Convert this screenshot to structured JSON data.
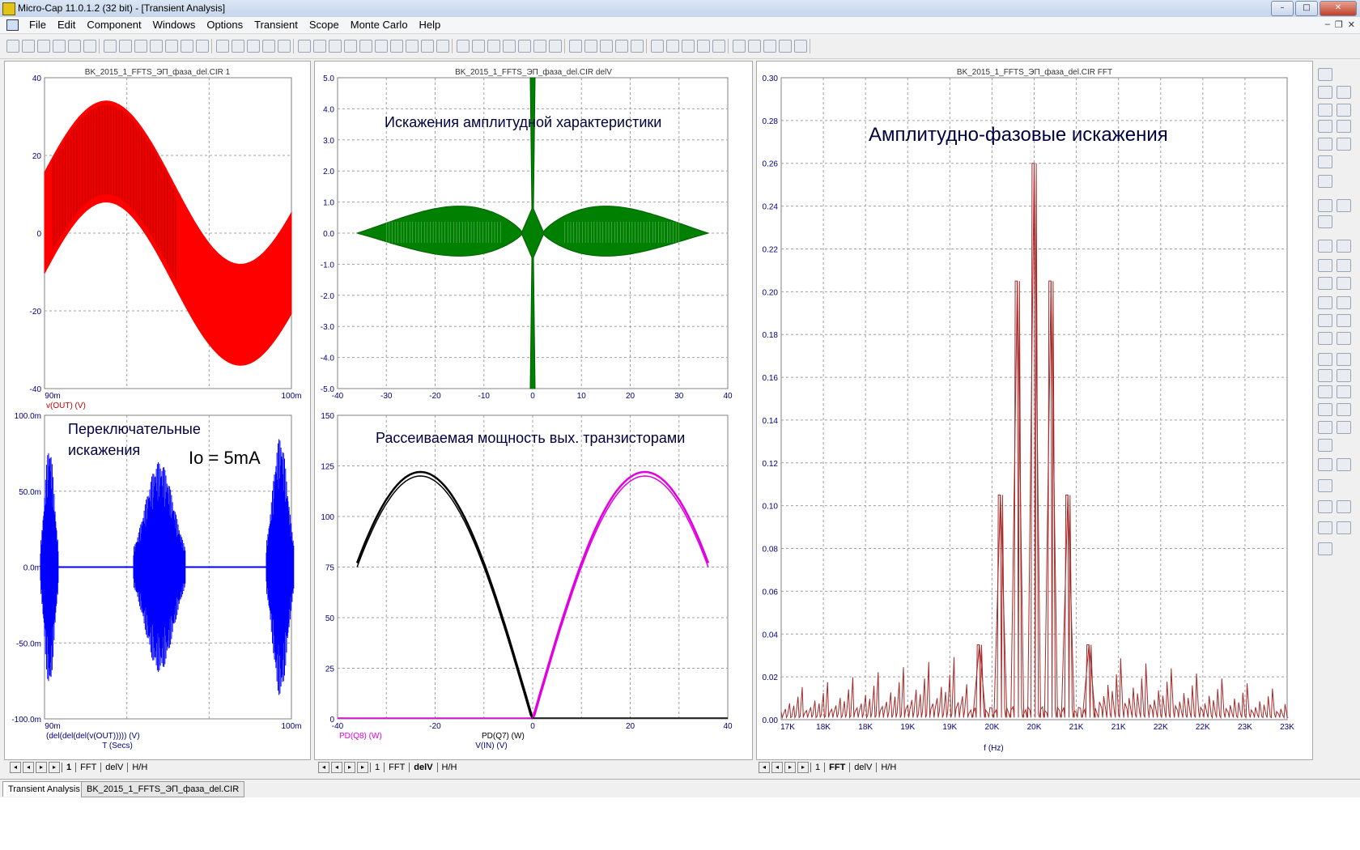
{
  "app": {
    "title": "Micro-Cap 11.0.1.2 (32 bit) - [Transient Analysis]"
  },
  "menu": [
    "File",
    "Edit",
    "Component",
    "Windows",
    "Options",
    "Transient",
    "Scope",
    "Monte Carlo",
    "Help"
  ],
  "panels": {
    "p1": {
      "title": "BK_2015_1_FFTS_ЭП_фаза_del.CIR 1",
      "yticks": [
        "40",
        "20",
        "0",
        "-20",
        "-40"
      ],
      "xticks": [
        "90m",
        "100m"
      ],
      "xlabel": "v(OUT) (V)",
      "color": "#ff0000"
    },
    "p2": {
      "title": "BK_2015_1_FFTS_ЭП_фаза_del.CIR delV",
      "annotation": "Искажения амплитудной характеристики",
      "yticks": [
        "5.0",
        "4.0",
        "3.0",
        "2.0",
        "1.0",
        "0.0",
        "-1.0",
        "-2.0",
        "-3.0",
        "-4.0",
        "-5.0"
      ],
      "xticks": [
        "-40",
        "-30",
        "-20",
        "-10",
        "0",
        "10",
        "20",
        "30",
        "40"
      ],
      "color": "#008000"
    },
    "p3": {
      "title": "BK_2015_1_FFTS_ЭП_фаза_del.CIR FFT",
      "annotation": "Амплитудно-фазовые искажения",
      "yticks": [
        "0.30",
        "0.28",
        "0.26",
        "0.24",
        "0.22",
        "0.20",
        "0.18",
        "0.16",
        "0.14",
        "0.12",
        "0.10",
        "0.08",
        "0.06",
        "0.04",
        "0.02",
        "0.00"
      ],
      "xticks": [
        "17K",
        "18K",
        "18K",
        "19K",
        "19K",
        "20K",
        "20K",
        "21K",
        "21K",
        "22K",
        "22K",
        "23K",
        "23K"
      ],
      "xlabel": "f (Hz)",
      "color": "#a52a2a"
    },
    "p4": {
      "annotation1": "Переключательные",
      "annotation2": "искажения",
      "annotation3": "Io = 5mA",
      "yticks": [
        "100.0m",
        "50.0m",
        "0.0m",
        "-50.0m",
        "-100.0m"
      ],
      "xticks": [
        "90m",
        "100m"
      ],
      "xlabel": "(del(del(del(v(OUT))))) (V)",
      "xlabel2": "T (Secs)",
      "color": "#0000ff"
    },
    "p5": {
      "annotation": "Рассеиваемая мощность вых. транзисторами",
      "yticks": [
        "150",
        "125",
        "100",
        "75",
        "50",
        "25",
        "0"
      ],
      "xticks": [
        "-40",
        "-20",
        "0",
        "20",
        "40"
      ],
      "legend1": "PD(Q8) (W)",
      "legend2": "PD(Q7) (W)",
      "xlabel": "V(IN) (V)",
      "color1": "#000000",
      "color2": "#e000e0"
    }
  },
  "tabs": {
    "left": [
      "1",
      "FFT",
      "delV",
      "H/H"
    ],
    "mid": [
      "1",
      "FFT",
      "delV",
      "H/H"
    ],
    "right": [
      "1",
      "FFT",
      "delV",
      "H/H"
    ]
  },
  "bottom_tabs": [
    "Transient Analysis",
    "BK_2015_1_FFTS_ЭП_фаза_del.CIR"
  ],
  "chart_data": [
    {
      "type": "line",
      "title": "BK_2015_1_FFTS_ЭП_фаза_del.CIR 1",
      "ylim": [
        -40,
        40
      ],
      "xlim_labels": [
        "90m",
        "100m"
      ],
      "series": [
        {
          "name": "v(OUT) (V)",
          "upper": [
            14,
            34,
            8,
            -10,
            14
          ],
          "lower": [
            -14,
            8,
            -34,
            -24,
            -14
          ]
        }
      ]
    },
    {
      "type": "line",
      "title": "BK_2015_1_FFTS_ЭП_фаза_del.CIR FFT",
      "xlabel": "f (Hz)",
      "ylim": [
        0,
        0.3
      ],
      "peaks": [
        {
          "x_index": 4.7,
          "y": 0.035
        },
        {
          "x_index": 5.2,
          "y": 0.105
        },
        {
          "x_index": 5.6,
          "y": 0.205
        },
        {
          "x_index": 6.0,
          "y": 0.26
        },
        {
          "x_index": 6.4,
          "y": 0.205
        },
        {
          "x_index": 6.8,
          "y": 0.105
        },
        {
          "x_index": 7.3,
          "y": 0.035
        }
      ]
    },
    {
      "type": "line",
      "title": "",
      "xlabel": "V(IN) (V)",
      "ylim": [
        0,
        150
      ],
      "xlim": [
        -40,
        40
      ],
      "series": [
        {
          "name": "PD(Q8) (W)",
          "x": [
            -36,
            -30,
            -23,
            -15,
            -8,
            0
          ],
          "y": [
            86,
            115,
            122,
            108,
            65,
            0
          ]
        },
        {
          "name": "PD(Q7) (W)",
          "x": [
            0,
            8,
            15,
            23,
            30,
            36
          ],
          "y": [
            0,
            65,
            108,
            122,
            115,
            86
          ]
        }
      ]
    }
  ]
}
